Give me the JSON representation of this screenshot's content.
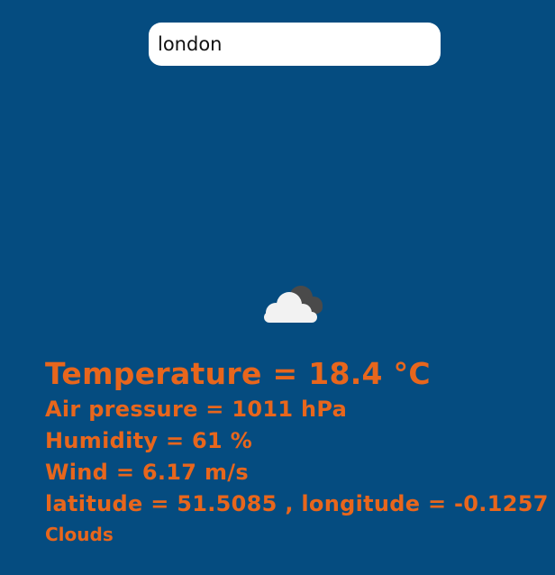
{
  "search": {
    "value": "london",
    "icon": "partly-cloudy-night-icon"
  },
  "weather": {
    "temperature_text": "Temperature = 18.4 °C",
    "pressure_text": "Air pressure = 1011 hPa",
    "humidity_text": "Humidity = 61 %",
    "wind_text": "Wind = 6.17 m/s",
    "coordinates_text": "latitude = 51.5085 , longitude = -0.1257",
    "description": "Clouds",
    "icon": "partly-cloudy-night-icon"
  },
  "colors": {
    "background": "#054c80",
    "accent_text": "#e8661c",
    "input_bg": "#ffffff",
    "cloud_front": "#f2f2f2",
    "cloud_back": "#4a4a4a"
  }
}
